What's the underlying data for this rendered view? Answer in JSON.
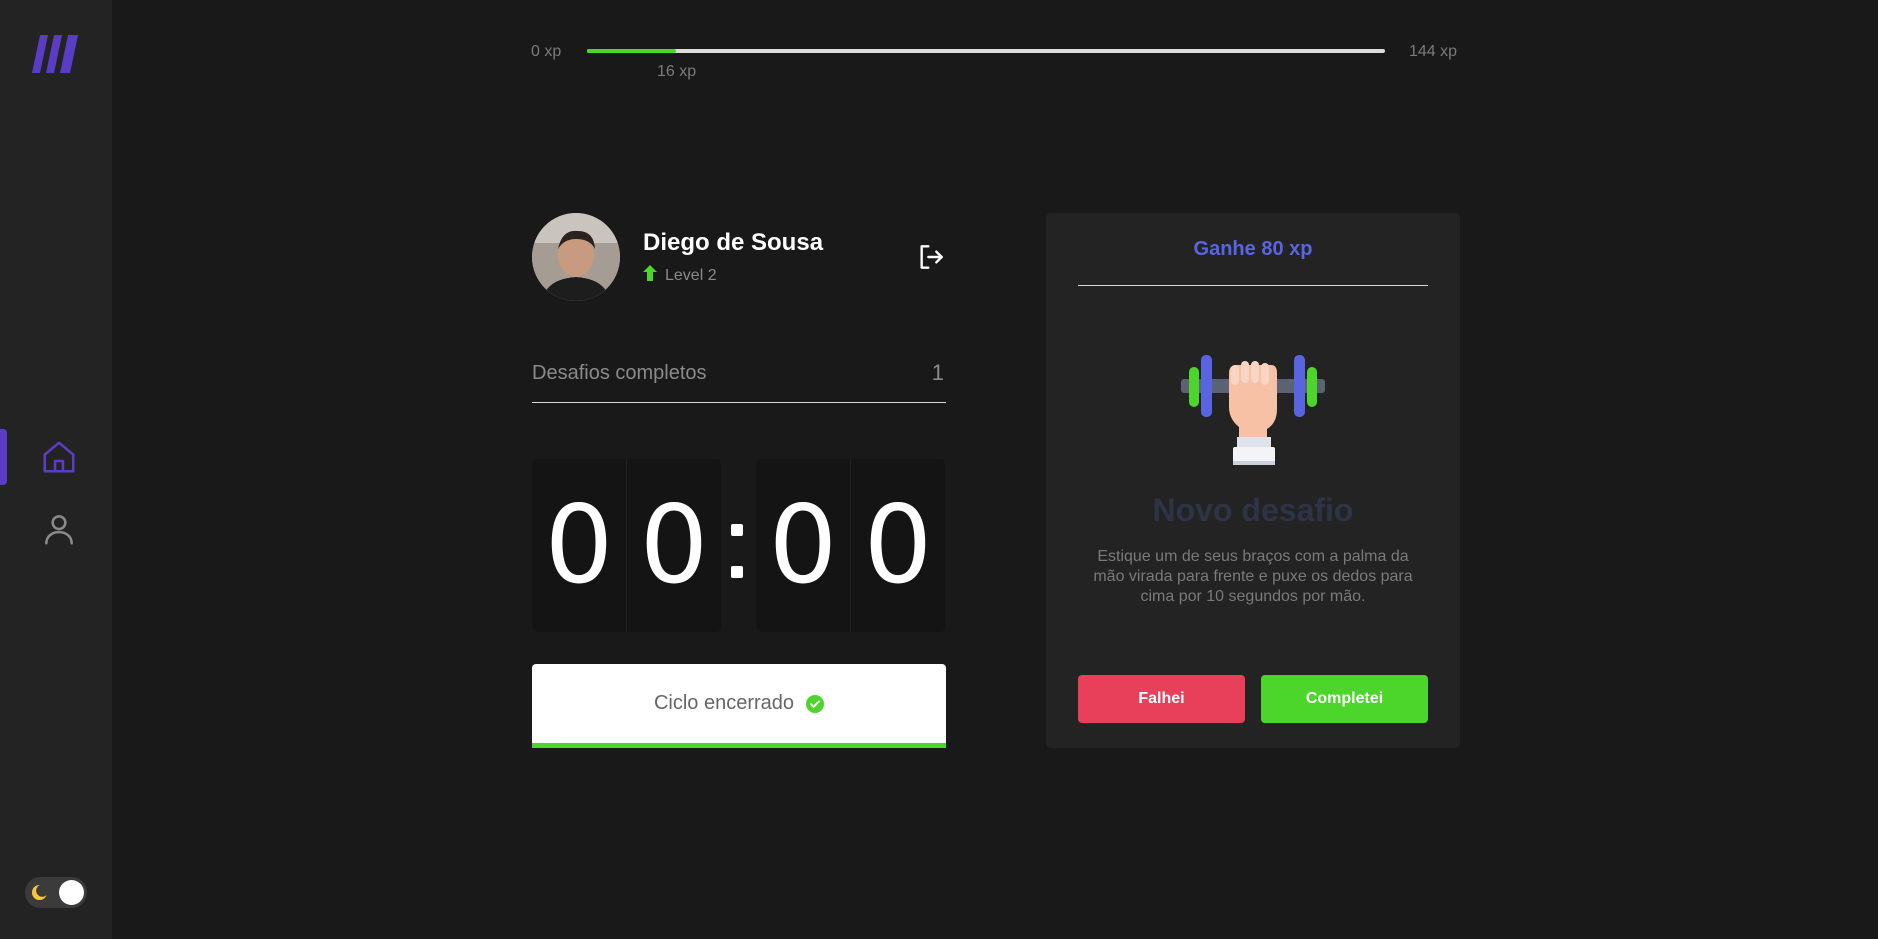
{
  "sidebar": {
    "nav": [
      "home",
      "profile"
    ],
    "active": "home",
    "accent_color": "#5b3cc4"
  },
  "xp": {
    "min_label": "0 xp",
    "max_label": "144 xp",
    "current_label": "16 xp",
    "progress_fraction": 0.111,
    "fill_color": "#4cd62b"
  },
  "profile": {
    "name": "Diego de Sousa",
    "level": "Level 2"
  },
  "challenges": {
    "label": "Desafios completos",
    "value": "1"
  },
  "countdown": {
    "minutes": [
      "0",
      "0"
    ],
    "seconds": [
      "0",
      "0"
    ]
  },
  "cycle": {
    "label": "Ciclo encerrado"
  },
  "challenge_card": {
    "reward": "Ganhe 80 xp",
    "title": "Novo desafio",
    "description": "Estique um de seus braços com a palma da mão virada para frente e puxe os dedos para cima por 10 segundos por mão.",
    "fail_label": "Falhei",
    "complete_label": "Completei",
    "icon": "dumbbell-icon"
  }
}
